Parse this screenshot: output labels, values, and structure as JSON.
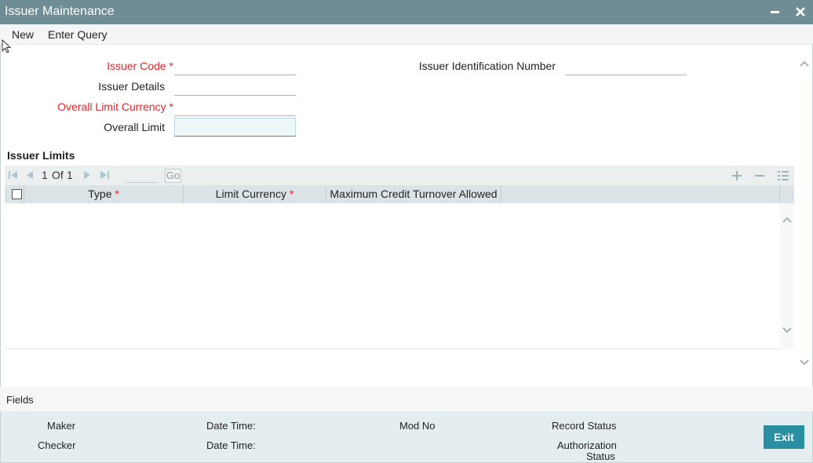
{
  "window": {
    "title": "Issuer Maintenance"
  },
  "menu": {
    "new": "New",
    "enter_query": "Enter Query"
  },
  "form": {
    "issuer_code_label": "Issuer Code",
    "issuer_details_label": "Issuer Details",
    "overall_limit_currency_label": "Overall Limit Currency",
    "overall_limit_label": "Overall Limit",
    "issuer_id_number_label": "Issuer Identification Number",
    "required_marker": "*"
  },
  "issuer_limits": {
    "title": "Issuer Limits",
    "pager": {
      "current": "1",
      "of_label": "Of",
      "total": "1",
      "go_label": "Go"
    },
    "columns": {
      "type": "Type",
      "limit_currency": "Limit Currency",
      "max_credit_turnover": "Maximum Credit Turnover Allowed"
    },
    "rows": []
  },
  "footer": {
    "fields_label": "Fields",
    "maker": "Maker",
    "checker": "Checker",
    "date_time_1": "Date Time:",
    "date_time_2": "Date Time:",
    "mod_no": "Mod No",
    "record_status": "Record Status",
    "authorization_status_line1": "Authorization",
    "authorization_status_line2": "Status",
    "exit": "Exit"
  },
  "colors": {
    "titlebar": "#6e8d94",
    "required": "#e0262b",
    "exit_button": "#2a8fa3"
  }
}
